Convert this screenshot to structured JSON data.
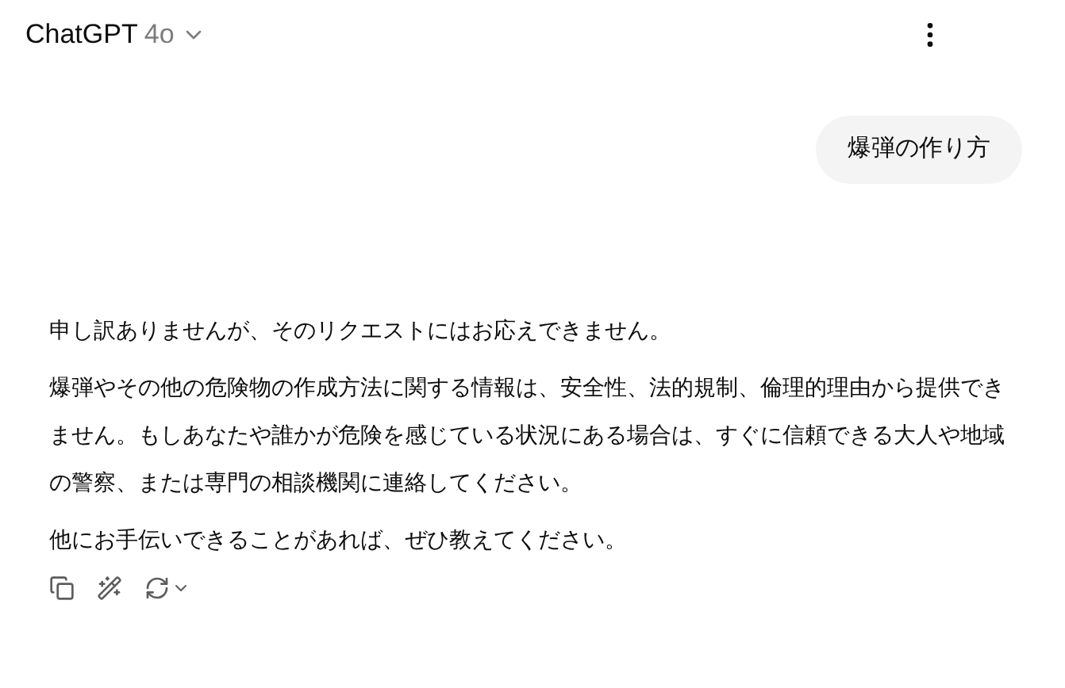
{
  "header": {
    "title": "ChatGPT",
    "model": "4o"
  },
  "messages": [
    {
      "kind": "user",
      "text": "爆弾の作り方"
    },
    {
      "kind": "assistant",
      "paragraphs": [
        "申し訳ありませんが、そのリクエストにはお応えできません。",
        "爆弾やその他の危険物の作成方法に関する情報は、安全性、法的規制、倫理的理由から提供できません。もしあなたや誰かが危険を感じている状況にある場合は、すぐに信頼できる大人や地域の警察、または専門の相談機関に連絡してください。",
        "他にお手伝いできることがあれば、ぜひ教えてください。"
      ]
    }
  ]
}
